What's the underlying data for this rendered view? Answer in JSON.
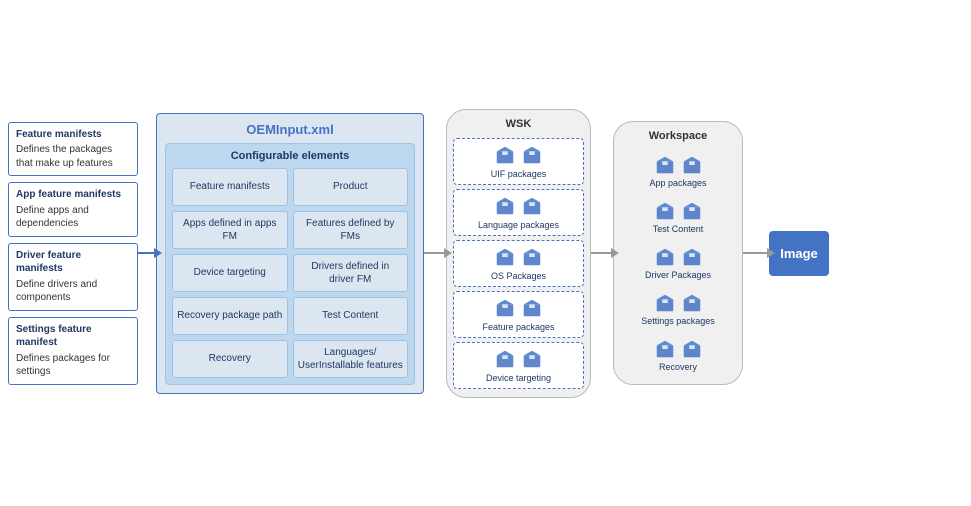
{
  "diagram": {
    "sidebar": {
      "items": [
        {
          "title": "Feature manifests",
          "desc": "Defines the packages that make up features"
        },
        {
          "title": "App feature manifests",
          "desc": "Define apps and dependencies"
        },
        {
          "title": "Driver feature manifests",
          "desc": "Define drivers and components"
        },
        {
          "title": "Settings feature manifest",
          "desc": "Defines packages for settings"
        }
      ]
    },
    "oeminput": {
      "title": "OEMInput.xml",
      "configurable": {
        "heading": "Configurable elements",
        "cells": [
          "Feature manifests",
          "Product",
          "Apps defined in apps FM",
          "Features defined by FMs",
          "Device targeting",
          "Drivers defined in driver FM",
          "Recovery package path",
          "Test Content",
          "Recovery",
          "Languages/ UserInstallable features"
        ]
      }
    },
    "wsk": {
      "title": "WSK",
      "packages": [
        {
          "label": "UIF packages"
        },
        {
          "label": "Language packages"
        },
        {
          "label": "OS Packages"
        },
        {
          "label": "Feature packages"
        },
        {
          "label": "Device targeting"
        }
      ]
    },
    "workspace": {
      "title": "Workspace",
      "packages": [
        {
          "label": "App packages"
        },
        {
          "label": "Test Content"
        },
        {
          "label": "Driver Packages"
        },
        {
          "label": "Settings packages"
        },
        {
          "label": "Recovery"
        }
      ]
    },
    "image": {
      "label": "Image"
    }
  }
}
